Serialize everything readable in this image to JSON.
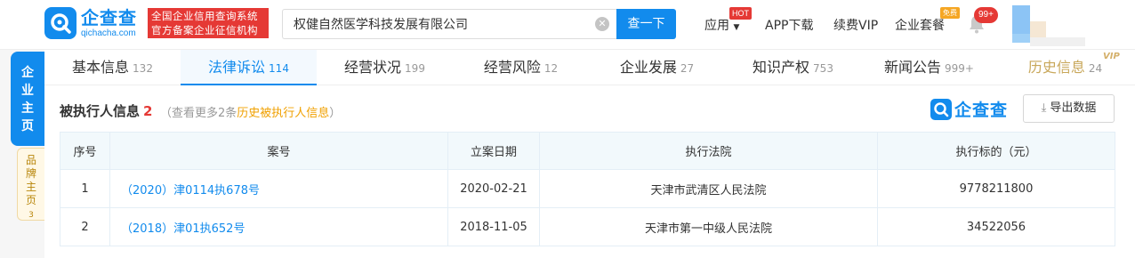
{
  "header": {
    "logo_cn": "企查查",
    "logo_en": "qichacha.com",
    "slogan_line1": "全国企业信用查询系统",
    "slogan_line2": "官方备案企业征信机构",
    "search_value": "权健自然医学科技发展有限公司",
    "search_button": "查一下",
    "nav": {
      "apply": "应用",
      "hot": "HOT",
      "app_download": "APP下载",
      "renew_vip": "续费VIP",
      "enterprise_package": "企业套餐",
      "free_tag": "免费",
      "notifications": "99+"
    }
  },
  "sidebar": {
    "primary": "企业主页",
    "secondary": "品牌主页",
    "secondary_count": "3"
  },
  "tabs": [
    {
      "label": "基本信息",
      "count": "132"
    },
    {
      "label": "法律诉讼",
      "count": "114"
    },
    {
      "label": "经营状况",
      "count": "199"
    },
    {
      "label": "经营风险",
      "count": "12"
    },
    {
      "label": "企业发展",
      "count": "27"
    },
    {
      "label": "知识产权",
      "count": "753"
    },
    {
      "label": "新闻公告",
      "count": "999+"
    },
    {
      "label": "历史信息",
      "count": "24"
    }
  ],
  "vip_tag": "VIP",
  "section": {
    "title": "被执行人信息",
    "count": "2",
    "more_prefix": "（查看更多2条",
    "more_link": "历史被执行人信息",
    "more_suffix": "）",
    "watermark": "企查查",
    "export_label": "导出数据"
  },
  "table": {
    "headers": [
      "序号",
      "案号",
      "立案日期",
      "执行法院",
      "执行标的（元）"
    ],
    "rows": [
      [
        "1",
        "（2020）津0114执678号",
        "2020-02-21",
        "天津市武清区人民法院",
        "9778211800"
      ],
      [
        "2",
        "（2018）津01执652号",
        "2018-11-05",
        "天津市第一中级人民法院",
        "34522056"
      ]
    ]
  },
  "colors": {
    "brand_blue": "#128bed",
    "alert_red": "#e53935",
    "link_orange": "#f0a000"
  }
}
